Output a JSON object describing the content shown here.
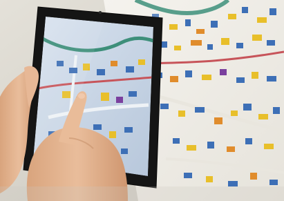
{
  "palette": {
    "wall": "#d9d6ce",
    "map_paper": "#f2f0ea",
    "map_water": "#3d8f7a",
    "map_road_red": "#c7545a",
    "map_road_pale": "#e9e6de",
    "building_blue": "#3d6fb6",
    "building_yellow": "#e8bf2a",
    "building_orange": "#e08c2c",
    "building_purple": "#7a3f9e",
    "tablet_frame": "#151515",
    "tablet_screen": "#c9d6e7",
    "skin": "#e2b491",
    "skin_shadow": "#c8926c"
  },
  "icons": {
    "tablet_camera": "camera-dot-icon"
  }
}
